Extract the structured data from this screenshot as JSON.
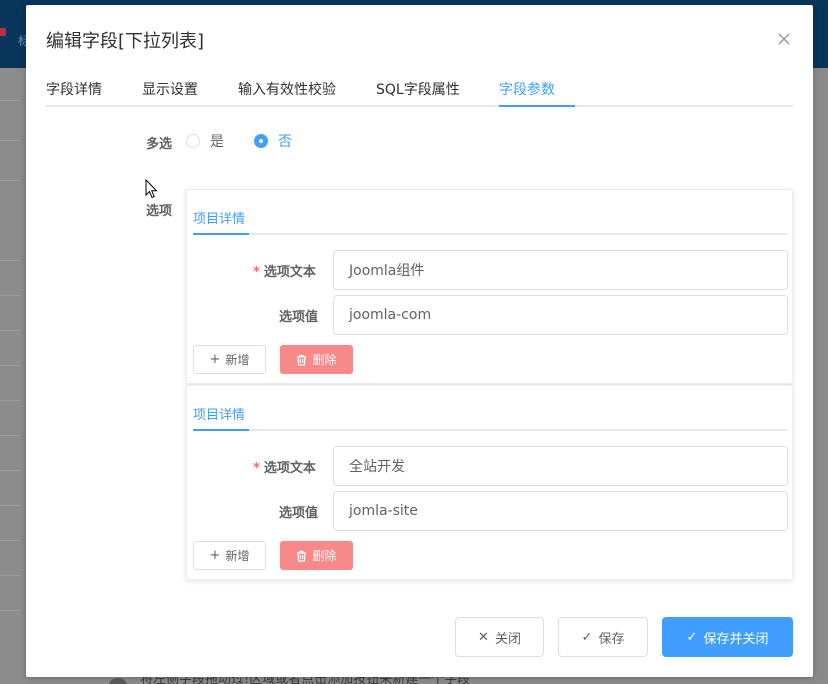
{
  "background": {
    "top_char": "标",
    "bottom_text": "将左侧字段拖动过!区域或者点击添加按钮来新建一个字段"
  },
  "dialog": {
    "title": "编辑字段[下拉列表]",
    "tabs": [
      {
        "label": "字段详情"
      },
      {
        "label": "显示设置"
      },
      {
        "label": "输入有效性校验"
      },
      {
        "label": "SQL字段属性"
      },
      {
        "label": "字段参数",
        "active": true
      }
    ],
    "multi_select": {
      "label": "多选",
      "options": [
        {
          "label": "是",
          "checked": false
        },
        {
          "label": "否",
          "checked": true
        }
      ]
    },
    "options_label": "选项",
    "items": [
      {
        "tab": "项目详情",
        "text_label": "选项文本",
        "text_value": "Joomla组件",
        "value_label": "选项值",
        "value_value": "joomla-com",
        "add_label": "新增",
        "delete_label": "删除"
      },
      {
        "tab": "项目详情",
        "text_label": "选项文本",
        "text_value": "全站开发",
        "value_label": "选项值",
        "value_value": "jomla-site",
        "add_label": "新增",
        "delete_label": "删除"
      }
    ],
    "footer": {
      "close_label": "关闭",
      "save_label": "保存",
      "save_close_label": "保存并关闭"
    }
  },
  "colors": {
    "primary": "#409eff",
    "danger": "#f78989",
    "required": "#f56c6c"
  }
}
